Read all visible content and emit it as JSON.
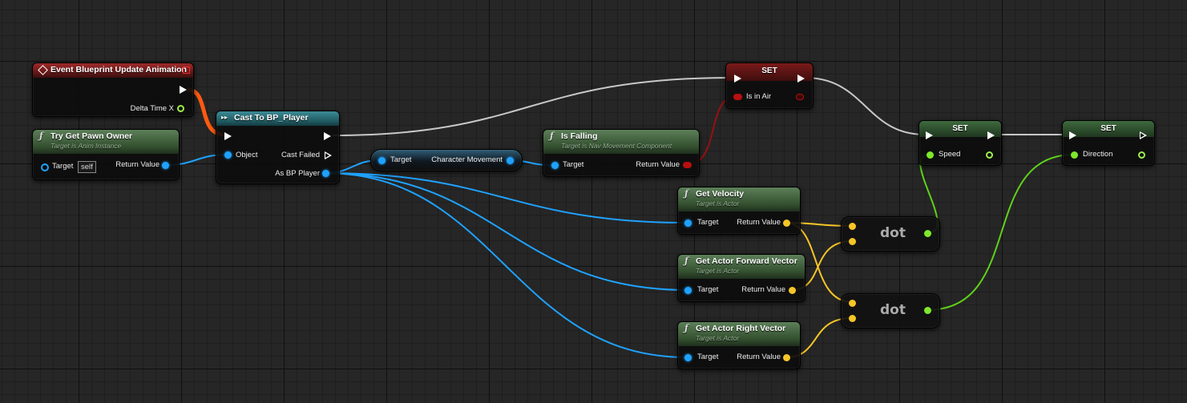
{
  "nodes": {
    "event": {
      "title": "Event Blueprint Update Animation",
      "pin_delta": "Delta Time X"
    },
    "pawn": {
      "title": "Try Get Pawn Owner",
      "subtitle": "Target is Anim Instance",
      "pin_target": "Target",
      "self_value": "self",
      "pin_return": "Return Value"
    },
    "cast": {
      "title": "Cast To BP_Player",
      "pin_object": "Object",
      "pin_failed": "Cast Failed",
      "pin_as": "As BP Player"
    },
    "charmove": {
      "pin_target": "Target",
      "pin_out": "Character Movement"
    },
    "falling": {
      "title": "Is Falling",
      "subtitle": "Target is Nav Movement Component",
      "pin_target": "Target",
      "pin_return": "Return Value"
    },
    "set_air": {
      "title": "SET",
      "pin": "Is in Air"
    },
    "set_speed": {
      "title": "SET",
      "pin": "Speed"
    },
    "set_dir": {
      "title": "SET",
      "pin": "Direction"
    },
    "velocity": {
      "title": "Get Velocity",
      "subtitle": "Target is Actor",
      "pin_target": "Target",
      "pin_return": "Return Value"
    },
    "forward": {
      "title": "Get Actor Forward Vector",
      "subtitle": "Target is Actor",
      "pin_target": "Target",
      "pin_return": "Return Value"
    },
    "right": {
      "title": "Get Actor Right Vector",
      "subtitle": "Target is Actor",
      "pin_target": "Target",
      "pin_return": "Return Value"
    },
    "dot1": {
      "label": "dot"
    },
    "dot2": {
      "label": "dot"
    }
  },
  "colors": {
    "exec": "#ffffff",
    "object": "#1fa2ff",
    "bool": "#b80f0f",
    "float": "#7ee82a",
    "vector": "#f6c526",
    "exec_active": "#ff5a10"
  }
}
